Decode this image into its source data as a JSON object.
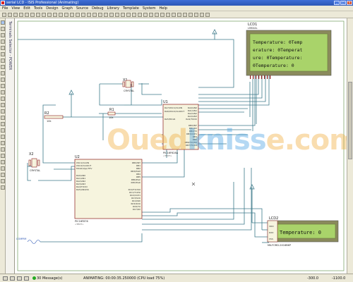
{
  "window": {
    "title": "serial LCD - ISIS Professional (Animating)",
    "controls": [
      "_",
      "□",
      "x"
    ]
  },
  "menu": [
    "File",
    "View",
    "Edit",
    "Tools",
    "Design",
    "Graph",
    "Source",
    "Debug",
    "Library",
    "Template",
    "System",
    "Help"
  ],
  "toolbar_icons": [
    "new-icon",
    "open-icon",
    "save-icon",
    "import-icon",
    "export-icon",
    "print-icon",
    "area-icon",
    "refresh-icon",
    "grid-icon",
    "origin-icon",
    "pan-icon",
    "zoom-in-icon",
    "zoom-out-icon",
    "zoom-all-icon",
    "zoom-area-icon",
    "undo-icon",
    "redo-icon",
    "cut-icon",
    "copy-icon",
    "paste-icon",
    "block-copy-icon",
    "block-move-icon",
    "block-rotate-icon",
    "block-delete-icon",
    "pick-icon",
    "make-device-icon",
    "packaging-icon",
    "decompose-icon",
    "wire-autorouter-icon",
    "search-tag-icon",
    "property-tool-icon",
    "new-sheet-icon",
    "remove-sheet-icon",
    "zoom-child-icon",
    "bom-icon",
    "erc-icon",
    "netlist-icon"
  ],
  "left_tools": [
    "selection-icon",
    "component-icon",
    "junction-icon",
    "wire-label-icon",
    "text-script-icon",
    "bus-icon",
    "subcircuit-icon",
    "terminal-icon",
    "pin-icon",
    "graph-icon",
    "tape-icon",
    "generator-icon",
    "probe-v-icon",
    "probe-i-icon",
    "instrument-icon",
    "line-icon",
    "box-icon",
    "circle-icon",
    "arc-icon",
    "path-icon",
    "text-icon",
    "symbol-icon",
    "marker-icon",
    "rotate-cw-icon",
    "rotate-ccw-icon",
    "mirror-x-icon",
    "mirror-y-icon"
  ],
  "selector_label": "Terminals Selector - POWER",
  "components": {
    "lcd1_name": "LCD1",
    "lcd1_part": "LM044L",
    "lcd1_lines": [
      "Temperature:  0Temp",
      "erature:  0Temperat",
      "ure:  0Temperature:",
      "  0Temperature:  0"
    ],
    "lcd2_name": "LCD2",
    "lcd2_part": "MILFORD-2X16BKP",
    "lcd2_text": "Temperature:  0",
    "lcd2_pins": [
      "VDD",
      "RXD",
      "VSS"
    ],
    "u1_name": "U1",
    "u1_part": "PIC16F628A",
    "u1_text": "<TEXT>",
    "u1_left_pins": [
      "RA7/OSC1/CLKIN",
      "RA6/OSC2/CLKOUT",
      "",
      "RA5/MCLR"
    ],
    "u1_right_pins": [
      "RA0/AN0",
      "RA1/AN1",
      "RA2/AN2",
      "RA3/AN3",
      "RA4/T0CKI",
      "",
      "RB0/INT",
      "RB1/RX",
      "RB2/TX",
      "RB3/CCP1",
      "RB4",
      "RB5",
      "RB6/T1OSO",
      "RB7/T1OSI"
    ],
    "u2_name": "U2",
    "u2_part": "PIC16F876",
    "u2_text": "<TEXT>",
    "u2_left_pins": [
      "OSC1/CLKIN",
      "OSC2/CLKOUT",
      "MCLR/Vpp/THV",
      "",
      "RA0/AN0",
      "RA1/AN1",
      "RA2/AN2",
      "RA3/AN3",
      "RA4/T0CKI",
      "RA5/AN4/SS"
    ],
    "u2_right_pins": [
      "RB0/INT",
      "RB1",
      "RB2",
      "RB3/PGM",
      "RB4",
      "RB5",
      "RB6/PGC",
      "RB7/PGD",
      "",
      "RC0/T1OSO",
      "RC1/T1OSI",
      "RC2/CCP1",
      "RC3/SCK",
      "RC4/SDI",
      "RC5/SDO",
      "RC6/TX",
      "RC7/RX"
    ],
    "x1_name": "X1",
    "x1_part": "CRYSTAL",
    "x2_name": "X2",
    "x2_part": "CRYSTAL",
    "r1_name": "R1",
    "r1_val": "10k",
    "r2_name": "R2",
    "r2_val": "10k",
    "probe_label": "COMPIM"
  },
  "watermark": {
    "left": "Oued",
    "mid": "kniss",
    "right": "e.com"
  },
  "status": {
    "message_count": "30 Message(s)",
    "animating": "ANIMATING: 00:00:35.250000 (CPU load 75%)",
    "coord_x": "-300.0",
    "coord_y": "-1100.0"
  },
  "colors": {
    "wire": "#3d7a8a",
    "component_fill": "#f6f4de",
    "component_stroke": "#8b1a1a",
    "lcd_bg": "#a9d36a",
    "lcd_frame": "#8a8a5c",
    "sheet_border": "#7fa86f"
  }
}
